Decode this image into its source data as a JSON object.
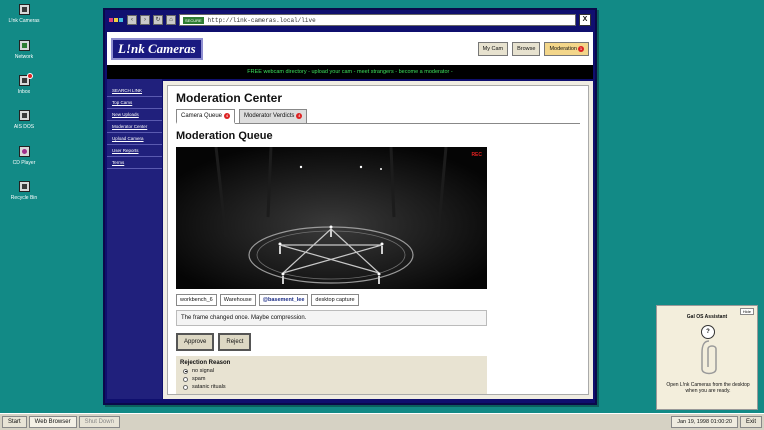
{
  "desktop": {
    "icons": [
      {
        "label": "L!nk Cameras",
        "icon": "camera-icon"
      },
      {
        "label": "Network",
        "icon": "network-icon"
      },
      {
        "label": "Inbox",
        "icon": "inbox-icon",
        "badge": true
      },
      {
        "label": "AIS DOS",
        "icon": "terminal-icon"
      },
      {
        "label": "CD Player",
        "icon": "cd-icon"
      },
      {
        "label": "Recycle Bin",
        "icon": "recycle-icon"
      }
    ]
  },
  "browser": {
    "secure_label": "SECURE",
    "url": "http://link-cameras.local/live",
    "close_label": "X",
    "nav_glyphs": {
      "back": "‹",
      "forward": "›",
      "reload": "↻",
      "home": "⌂"
    }
  },
  "site": {
    "logo": "L!nk Cameras",
    "header_buttons": {
      "my_cam": "My Cam",
      "browse": "Browse",
      "moderation": "Moderation",
      "moderation_count": "1"
    },
    "ticker": "FREE webcam directory - upload your cam - meet strangers - become a moderator -",
    "sidebar": [
      "SEARCH L!NK",
      "Top Cams",
      "New Uploads",
      "Moderator Center",
      "Upload Camera",
      "User Reports",
      "Terms"
    ]
  },
  "main": {
    "title": "Moderation Center",
    "tabs": [
      {
        "label": "Camera Queue",
        "count": "4"
      },
      {
        "label": "Moderator Verdicts",
        "count": "4"
      }
    ],
    "queue_title": "Moderation Queue",
    "feed_rec": "REC",
    "chips": [
      "workbench_6",
      "Warehouse",
      "@basement_lee",
      "desktop capture"
    ],
    "message": "The frame changed once. Maybe compression.",
    "approve_label": "Approve",
    "reject_label": "Reject",
    "reason": {
      "label": "Rejection Reason",
      "options": [
        "no signal",
        "spam",
        "satanic rituals"
      ],
      "selected": "no signal"
    }
  },
  "assistant": {
    "hide_label": "Hide",
    "title": "Gal OS Assistant",
    "bubble": "?",
    "message": "Open L!nk Cameras from the desktop when you are ready."
  },
  "taskbar": {
    "start": "Start",
    "web_browser": "Web Browser",
    "shutdown": "Shut Down",
    "clock": "Jan 19, 1998 01:00:20",
    "exit": "Exit"
  },
  "colors": {
    "desktop": "#128a86",
    "window_frame": "#0f0f6e",
    "ticker_text": "#3de05c",
    "alert": "#d22222"
  }
}
